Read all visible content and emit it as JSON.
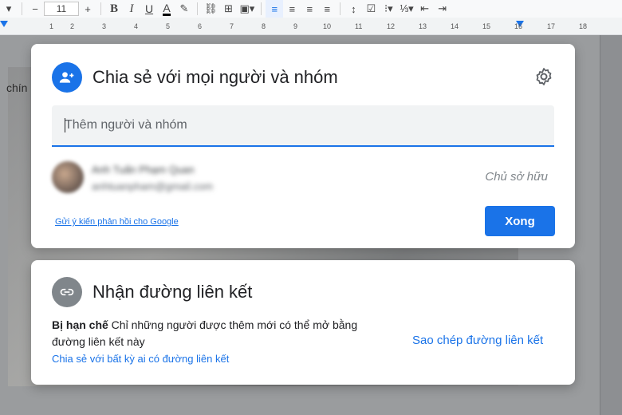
{
  "toolbar": {
    "font_size": "11",
    "minus": "−",
    "plus": "+",
    "bold": "B",
    "italic": "I",
    "underline": "U",
    "text_color": "A"
  },
  "ruler": {
    "ticks": [
      "1",
      "2",
      "3",
      "4",
      "5",
      "6",
      "7",
      "8",
      "9",
      "10",
      "11",
      "12",
      "13",
      "14",
      "15",
      "16",
      "17",
      "18"
    ]
  },
  "document": {
    "partial_word": "chín"
  },
  "share_dialog": {
    "title": "Chia sẻ với mọi người và nhóm",
    "settings_icon": "gear-icon",
    "add_people_placeholder": "Thêm người và nhóm",
    "person_name": "Anh Tuấn Phạm Quan",
    "person_email": "anhtuanpham@gmail.com",
    "owner_label": "Chủ sở hữu",
    "feedback_link": "Gửi ý kiến phản hồi cho Google",
    "done_button": "Xong"
  },
  "link_dialog": {
    "title": "Nhận đường liên kết",
    "restriction_bold": "Bị hạn chế",
    "restriction_text": " Chỉ những người được thêm mới có thể mở bằng đường liên kết này",
    "share_anyone_link": "Chia sẻ với bất kỳ ai có đường liên kết",
    "copy_link": "Sao chép đường liên kết"
  },
  "colors": {
    "accent": "#1a73e8",
    "overlay": "#5f6368"
  }
}
